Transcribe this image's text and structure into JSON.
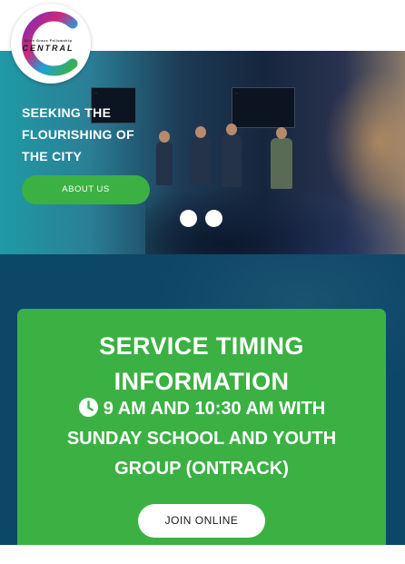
{
  "header": {
    "logo": {
      "line1": "Olive Grace Fellowship",
      "line2": "CENTRAL"
    },
    "menu_icon": "hamburger-menu-icon"
  },
  "hero": {
    "title_lines": [
      "SEEKING THE",
      "FLOURISHING OF",
      "THE CITY"
    ],
    "cta_label": "ABOUT US",
    "slides_count": 2,
    "accent_color": "#3bb143"
  },
  "service": {
    "title_lines": [
      "SERVICE TIMING",
      "INFORMATION"
    ],
    "time_lines": [
      "9 AM AND 10:30 AM WITH",
      "SUNDAY SCHOOL AND YOUTH",
      "GROUP (ONTRACK)"
    ],
    "time_icon": "clock-icon",
    "cta_label": "JOIN ONLINE",
    "background_color": "#0c4768",
    "card_color": "#3bb143"
  }
}
